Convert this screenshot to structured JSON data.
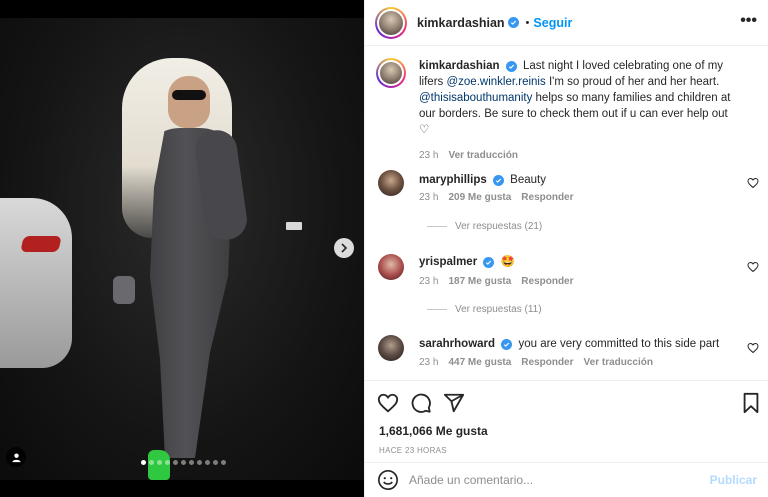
{
  "post": {
    "username": "kimkardashian",
    "follow_label": "Seguir",
    "more_label": "•••",
    "carousel_total": 11,
    "carousel_active": 0
  },
  "caption": {
    "username": "kimkardashian",
    "text_1": "Last night I loved celebrating one of my lifers",
    "mention_1": "@zoe.winkler.reinis",
    "text_2": "I'm so proud of her and her heart.",
    "mention_2": "@thisisabouthumanity",
    "text_3": "helps so many families and children at our borders. Be sure to check them out if u can ever help out",
    "emoji": "♡",
    "time": "23 h",
    "translate_label": "Ver traducción"
  },
  "comments": [
    {
      "username": "maryphillips",
      "text": "Beauty",
      "time": "23 h",
      "likes": "209 Me gusta",
      "reply_label": "Responder",
      "view_replies": "Ver respuestas (21)"
    },
    {
      "username": "yrispalmer",
      "text": "🤩",
      "time": "23 h",
      "likes": "187 Me gusta",
      "reply_label": "Responder",
      "view_replies": "Ver respuestas (11)"
    },
    {
      "username": "sarahrhoward",
      "text": "you are very committed to this side part",
      "time": "23 h",
      "likes": "447 Me gusta",
      "reply_label": "Responder",
      "translate_label": "Ver traducción"
    }
  ],
  "stats": {
    "likes": "1,681,066 Me gusta",
    "posted_ago": "HACE 23 HORAS"
  },
  "composer": {
    "placeholder": "Añade un comentario...",
    "publish_label": "Publicar"
  },
  "colors": {
    "link_blue": "#0095f6",
    "verified_blue": "#3897f0",
    "muted": "#8e8e8e",
    "publish_disabled": "#b3dbff"
  }
}
